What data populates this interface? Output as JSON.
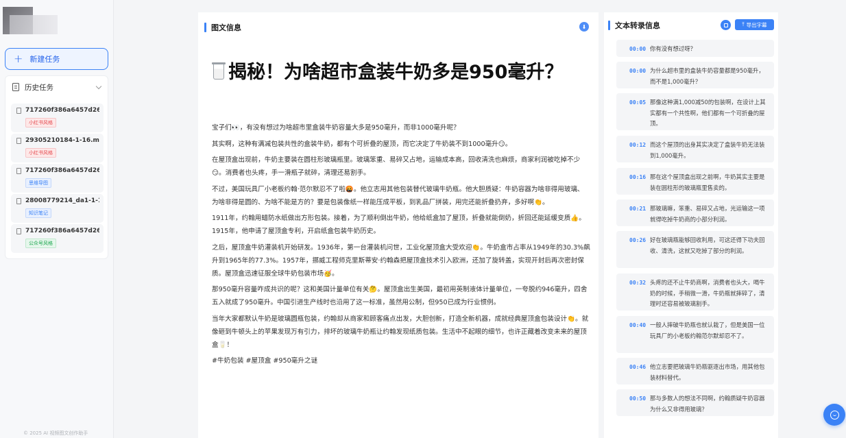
{
  "sidebar": {
    "new_task_label": "新建任务",
    "history_label": "历史任务",
    "history_items": [
      {
        "name": "717260f386a6457d26...",
        "tag": "小红书风格",
        "tag_color": "red"
      },
      {
        "name": "29305210184-1-16.mp4",
        "tag": "小红书风格",
        "tag_color": "red"
      },
      {
        "name": "717260f386a6457d26...",
        "tag": "思维导图",
        "tag_color": "blue"
      },
      {
        "name": "28008779214_da1-1-1...",
        "tag": "知识笔记",
        "tag_color": "blue"
      },
      {
        "name": "717260f386a6457d26...",
        "tag": "公众号风格",
        "tag_color": "green"
      }
    ],
    "footer": "© 2025 AI 视频图文创作助手"
  },
  "main": {
    "section_title": "图文信息",
    "article_title": "揭秘！为啥超市盒装牛奶多是950毫升？",
    "paragraphs": [
      "宝子们👀，有没有想过为啥超市里盒装牛奶容量大多是950毫升，而非1000毫升呢？",
      "其实啊，这种有满减包装共性的盒装牛奶，都有个可折叠的屋顶，而它决定了牛奶装不到1000毫升😏。",
      "在屋顶盒出现前，牛奶主要装在圆柱形玻璃瓶里。玻璃笨重、易碎又占地，运输成本高，回收清洗也麻烦，商家利润被吃掉不少😏。消费者也头疼，手一滑瓶子就碎，清理还易割手。",
      "不过，美国玩具厂小老板约翰·范尔默忍不了啦🤬。他立志用其他包装替代玻璃牛奶瓶。他大胆质疑：牛奶容器为啥非得用玻璃、为啥非得是圆的、为啥不能是方的？要是包装像纸一样能压成平板，到乳品厂拼装，用完还能折叠扔弃，多好啊👏。",
      "1911年，约翰用蜡防水纸做出方形包装。接着，为了顺利倒出牛奶，他给纸盒加了屋顶，折叠就能倒奶，折回还能延缓变质👍。1915年，他申请了屋顶盒专利，开启纸盒包装牛奶历史。",
      "之后，屋顶盒牛奶灌装机开始研发。1936年，第一台灌装机问世，工业化屋顶盒大受欢迎👏。牛奶盒市占率从1949年的30.3%飙升到1965年的77.3%。1957年，挪威工程师克里斯蒂安·约翰森把屋顶盒技术引入欧洲，还加了旋转盖，实现开封后再次密封保质。屋顶盒迅速征服全球牛奶包装市场🥳。",
      "那950毫升容量咋成共识的呢？这和美国计量单位有关🤔。屋顶盒出生美国，最初用英制液体计量单位，一夸脱约946毫升，四舍五入就成了950毫升。中国引进生产线时也沿用了这一标准，虽然用公制，但950已成为行业惯例。",
      "当年大家都默认牛奶是玻璃圆瓶包装，约翰却从商家和顾客痛点出发，大胆创新，打造全新机器，成就经典屋顶盒包装设计👏。就像砸到牛顿头上的苹果发现万有引力，排坏的玻璃牛奶瓶让约翰发现纸质包装。生活中不起眼的细节，也许正藏着改变未来的屋顶盒🥛！"
    ],
    "hashtags": "#牛奶包装 #屋顶盒 #950毫升之谜"
  },
  "transcript": {
    "section_title": "文本转录信息",
    "export_label": "导出字幕",
    "items": [
      {
        "time": "00:00",
        "text": "你有没有想过呀？"
      },
      {
        "time": "00:00",
        "text": "为什么超市里的盒装牛奶容量都是950毫升，而不是1,000毫升？"
      },
      {
        "time": "00:05",
        "text": "那像这种满1,000减50的包装啊，在设计上其实都有一个共性啊，他们都有一个可折叠的屋顶。"
      },
      {
        "time": "00:12",
        "text": "而这个屋顶的出身其实决定了盒装牛奶无法装到1,000毫升。"
      },
      {
        "time": "00:16",
        "text": "那在这个屋顶盒出现之前啊，牛奶其实主要是装在圆柱形的玻璃瓶里售卖的。"
      },
      {
        "time": "00:21",
        "text": "那玻璃嘛，笨重、易碎又占地，光运输这一项就得吃掉牛奶商的小部分利润。"
      },
      {
        "time": "00:26",
        "text": "好在玻璃瓶能够回收利用，可这还得下功夫回收、清洗，这就又吃掉了部分的利润。"
      },
      {
        "time": "00:32",
        "text": "头疼的还不止牛奶商啊，消费者也头大，喝牛奶的时候，手稍微一滑，牛奶瓶就摔碎了，清理时还容易被玻璃割手。"
      },
      {
        "time": "00:40",
        "text": "一般人摔破牛奶瓶也就认栽了，但是美国一位玩具厂的小老板约翰范尔默却忍不了。"
      },
      {
        "time": "00:46",
        "text": "他立志要把玻璃牛奶瓶驱逐出市场，用其他包装材料替代。"
      },
      {
        "time": "00:50",
        "text": "那与多数人的想法不同啊，约翰质疑牛奶容器为什么又非得用玻璃？"
      }
    ]
  },
  "colors": {
    "accent": "#3b82f6"
  }
}
